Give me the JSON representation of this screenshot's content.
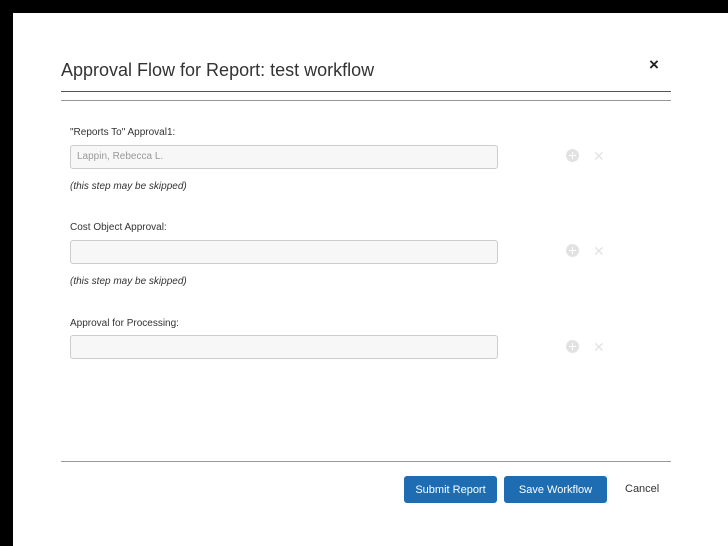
{
  "dialog": {
    "title": "Approval Flow for Report: test workflow",
    "close_label": "×"
  },
  "steps": [
    {
      "label": "\"Reports To\" Approval1:",
      "value": "",
      "placeholder": "Lappin, Rebecca L.",
      "note": "(this step may be skipped)"
    },
    {
      "label": "Cost Object Approval:",
      "value": "",
      "placeholder": "",
      "note": "(this step may be skipped)"
    },
    {
      "label": "Approval for Processing:",
      "value": "",
      "placeholder": "",
      "note": ""
    }
  ],
  "icons": {
    "add": "plus-circle-icon",
    "remove": "x-icon",
    "remove_glyph": "✕"
  },
  "footer": {
    "submit_label": "Submit Report",
    "save_label": "Save Workflow",
    "cancel_label": "Cancel"
  },
  "colors": {
    "primary_button": "#1e6db3",
    "disabled_icon": "#e2e2e2",
    "text": "#333333"
  }
}
